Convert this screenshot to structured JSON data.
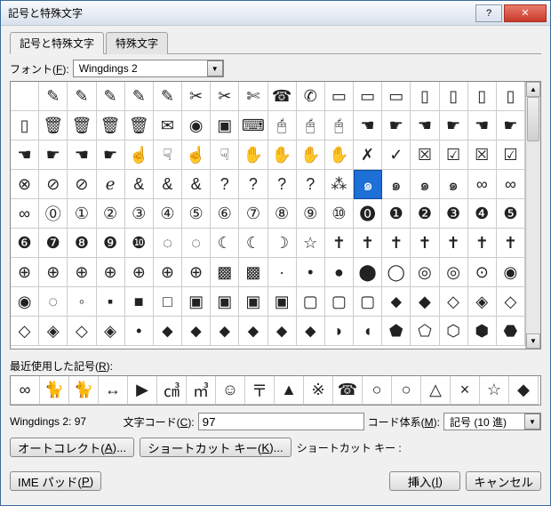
{
  "title": "記号と特殊文字",
  "tabs": {
    "symbols": "記号と特殊文字",
    "special": "特殊文字"
  },
  "font": {
    "label_pre": "フォント(",
    "label_u": "F",
    "label_post": "):",
    "value": "Wingdings 2"
  },
  "grid": {
    "rows": [
      [
        "",
        "✎",
        "✎",
        "✎",
        "✎",
        "✎",
        "✂",
        "✂",
        "✄",
        "☎",
        "✆",
        "▭",
        "▭",
        "▭",
        "▯",
        "▯",
        "▯",
        "▯"
      ],
      [
        "▯",
        "🗑",
        "🗑",
        "🗑",
        "🗑",
        "✉",
        "◉",
        "▣",
        "⌨",
        "🖰",
        "🖰",
        "🖰",
        "☚",
        "☛",
        "☚",
        "☛",
        "☚",
        "☛"
      ],
      [
        "☚",
        "☛",
        "☚",
        "☛",
        "☝",
        "☟",
        "☝",
        "☟",
        "✋",
        "✋",
        "✋",
        "✋",
        "✗",
        "✓",
        "☒",
        "☑",
        "☒",
        "☑"
      ],
      [
        "⊗",
        "⊘",
        "⊘",
        "ℯ",
        "&",
        "&",
        "&",
        "?",
        "?",
        "?",
        "?",
        "⁂",
        "๑",
        "๑",
        "๑",
        "๑",
        "∞",
        "∞"
      ],
      [
        "∞",
        "⓪",
        "①",
        "②",
        "③",
        "④",
        "⑤",
        "⑥",
        "⑦",
        "⑧",
        "⑨",
        "⑩",
        "⓿",
        "❶",
        "❷",
        "❸",
        "❹",
        "❺"
      ],
      [
        "❻",
        "❼",
        "❽",
        "❾",
        "❿",
        "◌",
        "◌",
        "☾",
        "☾",
        "☽",
        "☆",
        "✝",
        "✝",
        "✝",
        "✝",
        "✝",
        "✝",
        "✝"
      ],
      [
        "⊕",
        "⊕",
        "⊕",
        "⊕",
        "⊕",
        "⊕",
        "⊕",
        "▩",
        "▩",
        "·",
        "•",
        "●",
        "⬤",
        "◯",
        "◎",
        "◎",
        "⊙",
        "◉"
      ],
      [
        "◉",
        "◌",
        "◦",
        "▪",
        "■",
        "□",
        "▣",
        "▣",
        "▣",
        "▣",
        "▢",
        "▢",
        "▢",
        "⬥",
        "◆",
        "◇",
        "◈",
        "◇"
      ],
      [
        "◇",
        "◈",
        "◇",
        "◈",
        "•",
        "⬥",
        "⬥",
        "⬥",
        "⬥",
        "⬥",
        "⬥",
        "◗",
        "◖",
        "⬟",
        "⬠",
        "⬡",
        "⬢",
        "⬣"
      ]
    ],
    "selected": {
      "row": 3,
      "col": 12
    }
  },
  "recent": {
    "label_pre": "最近使用した記号(",
    "label_u": "R",
    "label_post": "):",
    "items": [
      "∞",
      "🐈",
      "🐈",
      "↔",
      "▶",
      "㎤",
      "㎥",
      "☺",
      "〒",
      "▲",
      "※",
      "☎",
      "○",
      "○",
      "△",
      "×",
      "☆",
      "◆"
    ]
  },
  "info": {
    "font_char": "Wingdings 2: 97",
    "code_label_pre": "文字コード(",
    "code_label_u": "C",
    "code_label_post": "):",
    "code_value": "97",
    "system_label_pre": "コード体系(",
    "system_label_u": "M",
    "system_label_post": "):",
    "system_value": "記号 (10 進)"
  },
  "buttons": {
    "autocorrect_pre": "オートコレクト(",
    "autocorrect_u": "A",
    "autocorrect_post": ")...",
    "shortcut_pre": "ショートカット キー(",
    "shortcut_u": "K",
    "shortcut_post": ")...",
    "shortcut_label": "ショートカット キー :",
    "imepad_pre": "IME パッド(",
    "imepad_u": "P",
    "imepad_post": ")",
    "insert_pre": "挿入(",
    "insert_u": "I",
    "insert_post": ")",
    "cancel": "キャンセル"
  },
  "win_btns": {
    "help": "?",
    "close": "✕"
  }
}
